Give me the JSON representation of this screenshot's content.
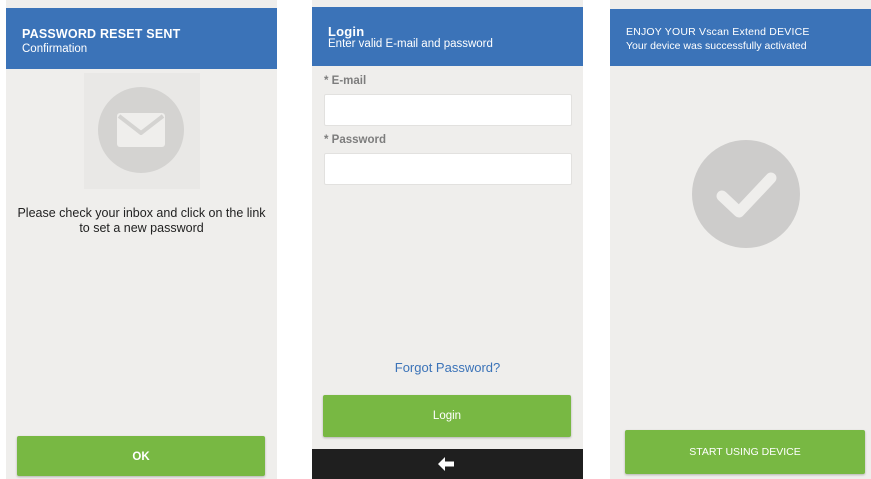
{
  "screen1": {
    "title": "PASSWORD RESET SENT",
    "subtitle": "Confirmation",
    "envelope_icon": "envelope-icon",
    "message_line1": "Please check your inbox and click on the link",
    "message_line2": "to set a new password",
    "ok_label": "OK"
  },
  "screen2": {
    "title": "Login",
    "subtitle": "Enter valid E-mail and password",
    "email_label": "* E-mail",
    "email_value": "",
    "password_label": "* Password",
    "password_value": "",
    "forgot_label": "Forgot Password?",
    "login_label": "Login",
    "back_icon": "back-arrow-icon"
  },
  "screen3": {
    "title": "ENJOY YOUR Vscan Extend DEVICE",
    "subtitle": "Your device was successfully activated",
    "check_icon": "checkmark-icon",
    "start_label": "START USING DEVICE"
  },
  "colors": {
    "header_blue": "#3b73b8",
    "button_green": "#78b843",
    "background": "#efeeec",
    "link_blue": "#3b73b8"
  }
}
